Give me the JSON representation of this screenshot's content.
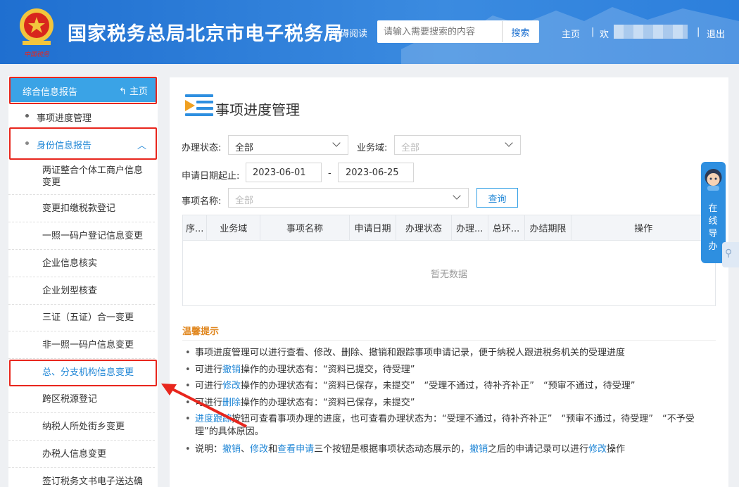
{
  "header": {
    "site_title": "国家税务总局北京市电子税务局",
    "access_label": "障碍阅读",
    "search_placeholder": "请输入需要搜索的内容",
    "search_button": "搜索",
    "nav_home": "主页",
    "nav_sep": "|",
    "nav_welcome": "欢",
    "nav_logout": "退出",
    "logo_text": "中国税务"
  },
  "sidebar": {
    "header_title": "综合信息报告",
    "header_home": "主页",
    "item_progress": "事项进度管理",
    "item_identity": "身份信息报告",
    "sub_items": [
      "两证整合个体工商户信息变更",
      "变更扣缴税款登记",
      "一照一码户登记信息变更",
      "企业信息核实",
      "企业划型核查",
      "三证（五证）合一变更",
      "非一照一码户信息变更",
      "总、分支机构信息变更",
      "跨区税源登记",
      "纳税人所处街乡变更",
      "办税人信息变更",
      "签订税务文书电子送达确认"
    ]
  },
  "main": {
    "page_title": "事项进度管理",
    "status_label": "办理状态:",
    "status_value": "全部",
    "domain_label": "业务域:",
    "domain_value": "全部",
    "date_label": "申请日期起止:",
    "date_start": "2023-06-01",
    "date_sep": "-",
    "date_end": "2023-06-25",
    "item_label": "事项名称:",
    "item_value": "全部",
    "query_button": "查询",
    "columns": [
      "序...",
      "业务域",
      "事项名称",
      "申请日期",
      "办理状态",
      "办理...",
      "总环...",
      "办结期限",
      "操作"
    ],
    "empty_text": "暂无数据",
    "tips_title": "温馨提示",
    "tips": {
      "t1": "事项进度管理可以进行查看、修改、删除、撤销和跟踪事项申请记录，便于纳税人跟进税务机关的受理进度",
      "t2_pre": "可进行",
      "t2_hl": "撤销",
      "t2_post": "操作的办理状态有：“资料已提交，待受理”",
      "t3_pre": "可进行",
      "t3_hl": "修改",
      "t3_post": "操作的办理状态有：“资料已保存，未提交”　“受理不通过，待补齐补正”　“预审不通过，待受理”",
      "t4_pre": "可进行",
      "t4_hl": "删除",
      "t4_post": "操作的办理状态有：“资料已保存，未提交”",
      "t5_hl": "进度跟踪",
      "t5_post": "按钮可查看事项办理的进度，也可查看办理状态为：“受理不通过，待补齐补正”　“预审不通过，待受理”　“不予受理”的具体原因。",
      "t6_pre": "说明：",
      "t6_hl1": "撤销",
      "t6_s1": "、",
      "t6_hl2": "修改",
      "t6_s2": "和",
      "t6_hl3": "查看申请",
      "t6_mid": "三个按钮是根据事项状态动态展示的，",
      "t6_hl4": "撤销",
      "t6_mid2": "之后的申请记录可以进行",
      "t6_hl5": "修改",
      "t6_end": "操作"
    }
  },
  "guide": {
    "text": "在线导办"
  },
  "colors": {
    "header_blue": "#2c7fdc",
    "accent": "#3aa3e6",
    "highlight": "#1f86d6",
    "warning": "#e0861d",
    "annotation_red": "#e8261d"
  }
}
